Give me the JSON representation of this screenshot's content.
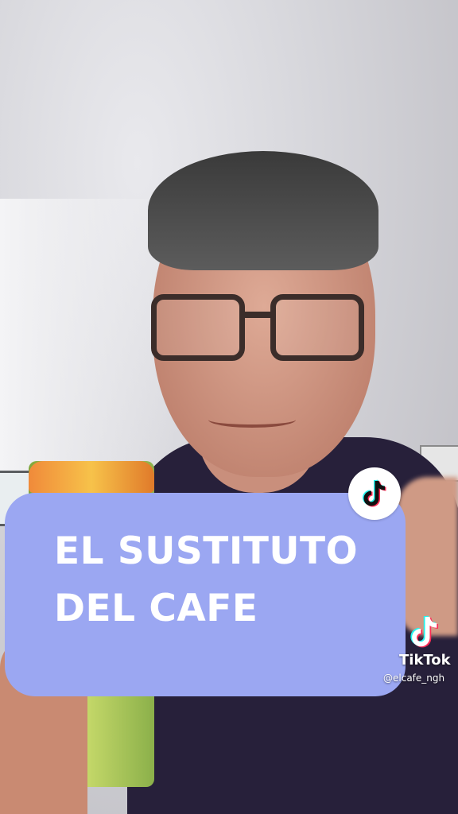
{
  "caption": {
    "line1": "EL SUSTITUTO",
    "line2": "DEL CAFE",
    "background_color": "#9ba7f2",
    "text_color": "#ffffff"
  },
  "badge": {
    "icon": "tiktok-note-icon"
  },
  "watermark": {
    "icon": "tiktok-logo-icon",
    "name": "TikTok",
    "handle": "@elcafe_ngh"
  }
}
